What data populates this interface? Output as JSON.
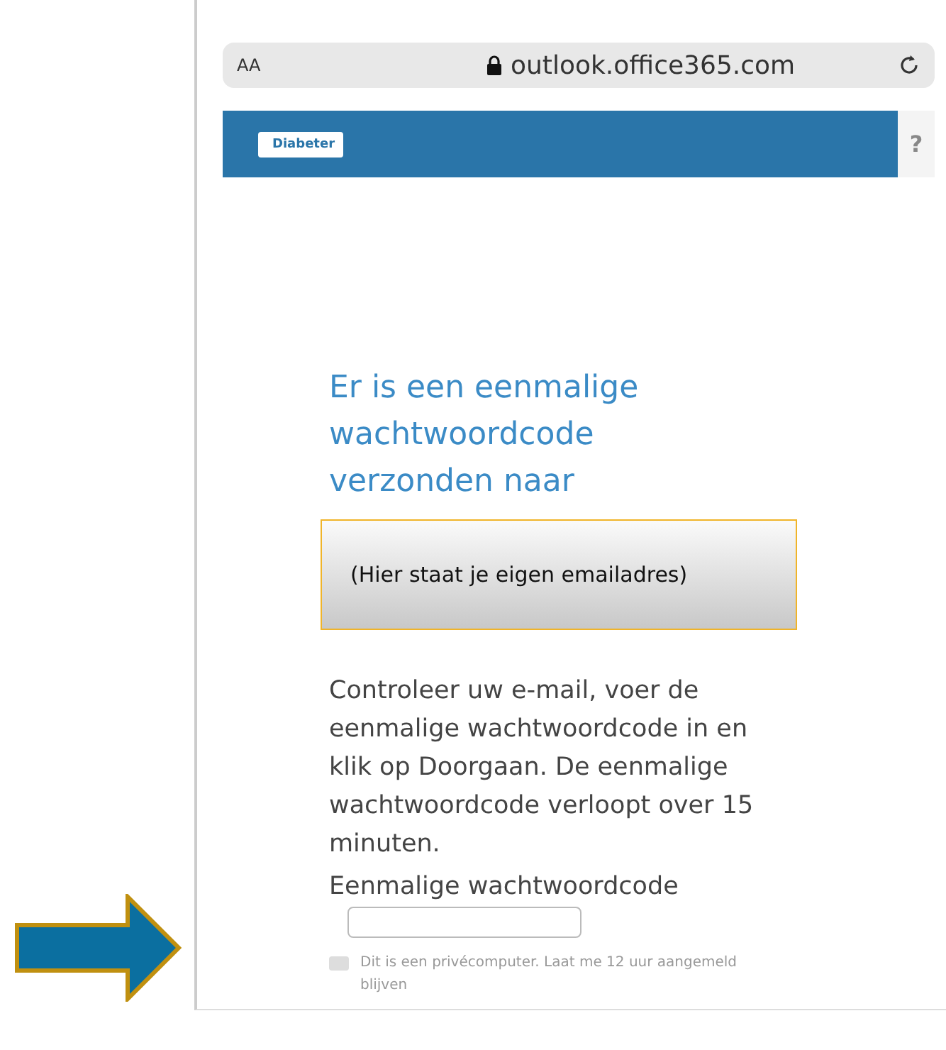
{
  "address_bar": {
    "text_size": "AA",
    "url": "outlook.office365.com"
  },
  "banner": {
    "logo": "Diabeter",
    "help": "?"
  },
  "heading": "Er is een eenmalige wachtwoordcode verzonden naar",
  "email_box": "(Hier staat je eigen emailadres)",
  "instructions": "Controleer uw e-mail, voer de eenmalige wachtwoordcode in en klik op Doorgaan. De eenmalige wachtwoordcode verloopt over 15 minuten.",
  "code_field": {
    "label": "Eenmalige wachtwoordcode"
  },
  "remember": {
    "label": "Dit is een privécomputer. Laat me 12 uur aangemeld blijven",
    "checked": false
  }
}
